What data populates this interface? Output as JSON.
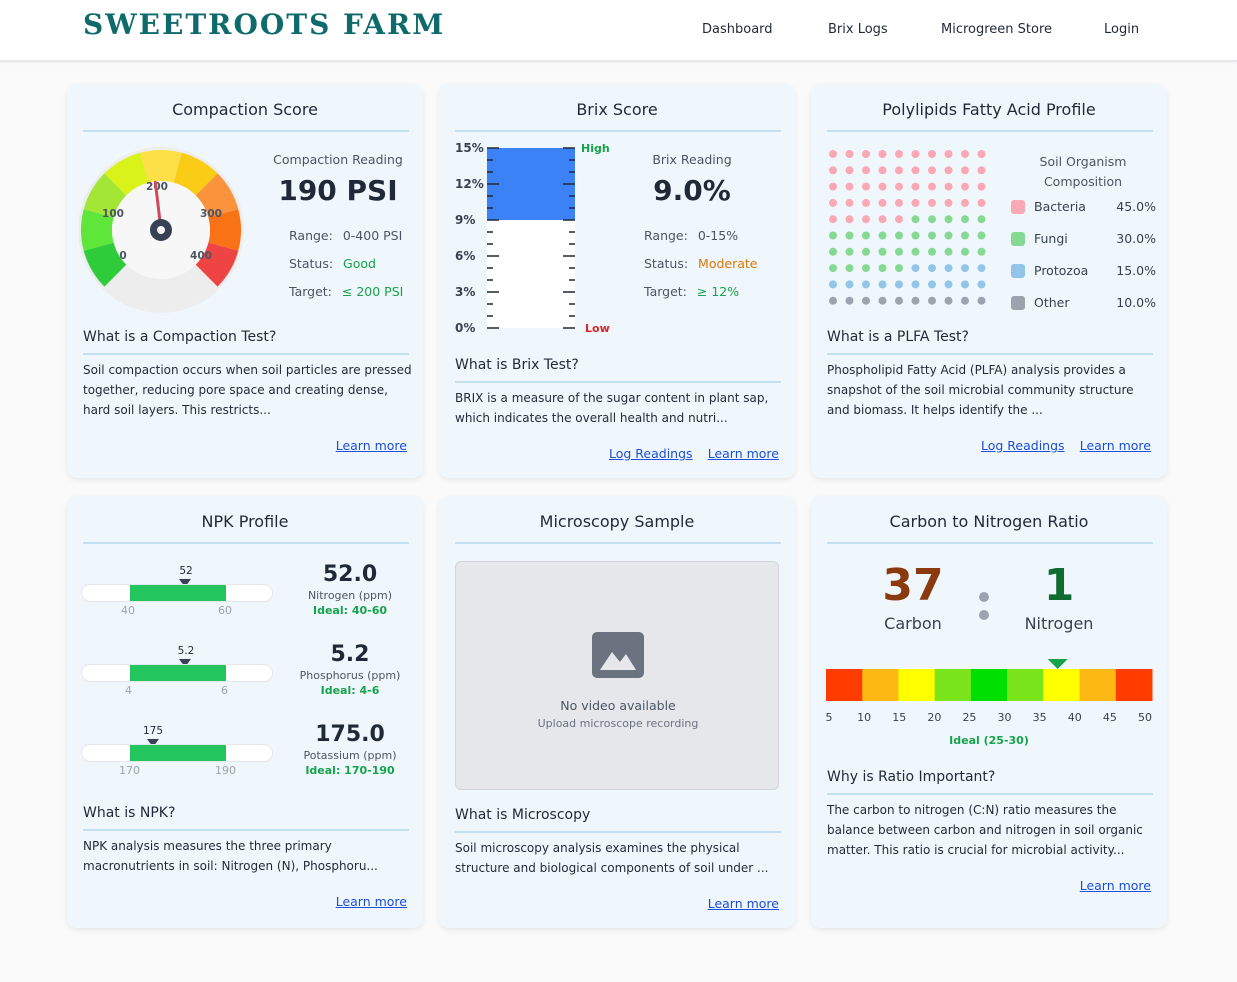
{
  "brand": "SWEETROOTS FARM",
  "nav": [
    "Dashboard",
    "Brix Logs",
    "Microgreen Store",
    "Login"
  ],
  "compaction": {
    "title": "Compaction Score",
    "reading_label": "Compaction Reading",
    "value": "190 PSI",
    "gauge_value": 190,
    "gauge_labels": [
      "0",
      "100",
      "200",
      "300",
      "400"
    ],
    "range_label": "Range:",
    "range": "0-400 PSI",
    "status_label": "Status:",
    "status": "Good",
    "target_label": "Target:",
    "target": "≤ 200 PSI",
    "what_title": "What is a Compaction Test?",
    "desc": "Soil compaction occurs when soil particles are pressed together, reducing pore space and creating dense, hard soil layers. This restricts...",
    "learn_more": "Learn more"
  },
  "brix": {
    "title": "Brix Score",
    "reading_label": "Brix Reading",
    "value": "9.0%",
    "level": 9.0,
    "scale_max": 15,
    "scale_labels": [
      "15%",
      "12%",
      "9%",
      "6%",
      "3%",
      "0%"
    ],
    "high": "High",
    "low": "Low",
    "range_label": "Range:",
    "range": "0-15%",
    "status_label": "Status:",
    "status": "Moderate",
    "target_label": "Target:",
    "target": "≥ 12%",
    "what_title": "What is Brix Test?",
    "desc": "BRIX is a measure of the sugar content in plant sap, which indicates the overall health and nutri...",
    "log_readings": "Log Readings",
    "learn_more": "Learn more"
  },
  "plfa": {
    "title": "Polylipids Fatty Acid Profile",
    "legend_title": "Soil Organism Composition",
    "items": [
      {
        "name": "Bacteria",
        "value": "45.0%",
        "color": "#f9a8b4"
      },
      {
        "name": "Fungi",
        "value": "30.0%",
        "color": "#86d993"
      },
      {
        "name": "Protozoa",
        "value": "15.0%",
        "color": "#93c5e8"
      },
      {
        "name": "Other",
        "value": "10.0%",
        "color": "#9ca3af"
      }
    ],
    "what_title": "What is a PLFA Test?",
    "desc": "Phospholipid Fatty Acid (PLFA) analysis provides a snapshot of the soil microbial community structure and biomass. It helps identify the ...",
    "log_readings": "Log Readings",
    "learn_more": "Learn more"
  },
  "npk": {
    "title": "NPK Profile",
    "rows": [
      {
        "pin": "52",
        "value": "52.0",
        "unit": "Nitrogen (ppm)",
        "ideal": "Ideal: 40-60",
        "min": "40",
        "max": "60",
        "pos": 0.6
      },
      {
        "pin": "5.2",
        "value": "5.2",
        "unit": "Phosphorus (ppm)",
        "ideal": "Ideal: 4-6",
        "min": "4",
        "max": "6",
        "pos": 0.6
      },
      {
        "pin": "175",
        "value": "175.0",
        "unit": "Potassium (ppm)",
        "ideal": "Ideal: 170-190",
        "min": "170",
        "max": "190",
        "pos": 0.25
      }
    ],
    "what_title": "What is NPK?",
    "desc": "NPK analysis measures the three primary macronutrients in soil: Nitrogen (N), Phosphoru...",
    "learn_more": "Learn more"
  },
  "microscopy": {
    "title": "Microscopy Sample",
    "no_video": "No video available",
    "upload_hint": "Upload microscope recording",
    "what_title": "What is Microscopy",
    "desc": "Soil microscopy analysis examines the physical structure and biological components of soil under ...",
    "learn_more": "Learn more"
  },
  "cn": {
    "title": "Carbon to Nitrogen Ratio",
    "carbon": "37",
    "carbon_label": "Carbon",
    "nitrogen": "1",
    "nitrogen_label": "Nitrogen",
    "ratio_value": 37,
    "scale_labels": [
      "5",
      "10",
      "15",
      "20",
      "25",
      "30",
      "35",
      "40",
      "45",
      "50"
    ],
    "scale_colors": [
      "#ff3b00",
      "#fdb813",
      "#ffff00",
      "#7be51b",
      "#00e000",
      "#7be51b",
      "#ffff00",
      "#fdb813",
      "#ff3b00"
    ],
    "ideal": "Ideal (25-30)",
    "what_title": "Why is Ratio Important?",
    "desc": "The carbon to nitrogen (C:N) ratio measures the balance between carbon and nitrogen in soil organic matter. This ratio is crucial for microbial activity...",
    "learn_more": "Learn more",
    "colors": {
      "carbon": "#8b3a0f",
      "nitrogen": "#0f6b2f",
      "marker": "#16a34a"
    }
  }
}
